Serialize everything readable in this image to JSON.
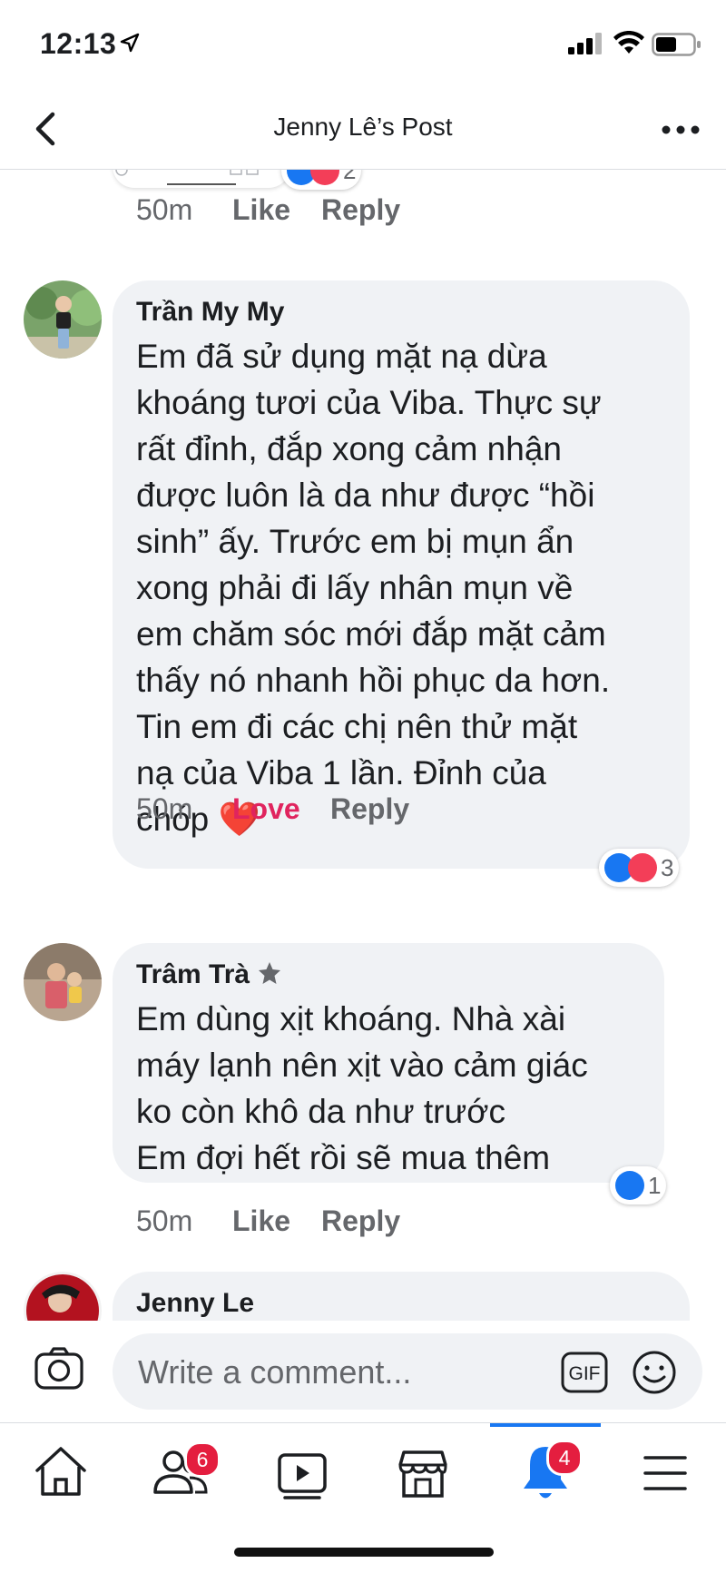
{
  "status_bar": {
    "time": "12:13"
  },
  "header": {
    "title": "Jenny Lê’s Post"
  },
  "prev_comment": {
    "time": "50m",
    "like": "Like",
    "reply": "Reply",
    "reaction_count": "2"
  },
  "comments": [
    {
      "author": "Trần My My",
      "text": "Em đã sử dụng mặt nạ dừa\nkhoáng tươi của Viba. Thực sự\nrất đỉnh, đắp xong cảm nhận\nđược luôn là da như được “hồi\nsinh” ấy. Trước em bị mụn ẩn\nxong phải đi lấy nhân mụn về\nem chăm sóc mới đắp mặt cảm\nthấy nó nhanh hồi phục da hơn.\nTin em đi các chị nên thử mặt\nnạ của Viba 1 lần. Đỉnh của\nchóp ❤️",
      "time": "50m",
      "reaction_label": "Love",
      "reply": "Reply",
      "reaction_count": "3"
    },
    {
      "author": "Trâm Trà",
      "text": "Em dùng xịt khoáng. Nhà xài\nmáy lạnh nên xịt vào cảm giác\nko còn khô da như trước\nEm đợi hết rồi sẽ mua thêm",
      "time": "50m",
      "reaction_label": "Like",
      "reply": "Reply",
      "reaction_count": "1"
    },
    {
      "author": "Jenny Le"
    }
  ],
  "composer": {
    "placeholder": "Write a comment...",
    "gif_label": "GIF"
  },
  "nav": {
    "friends_badge": "6",
    "notifications_badge": "4"
  },
  "colors": {
    "accent": "#1877f2",
    "love": "#e0245e",
    "badge": "#e41e3f",
    "bubble": "#f0f2f5"
  }
}
